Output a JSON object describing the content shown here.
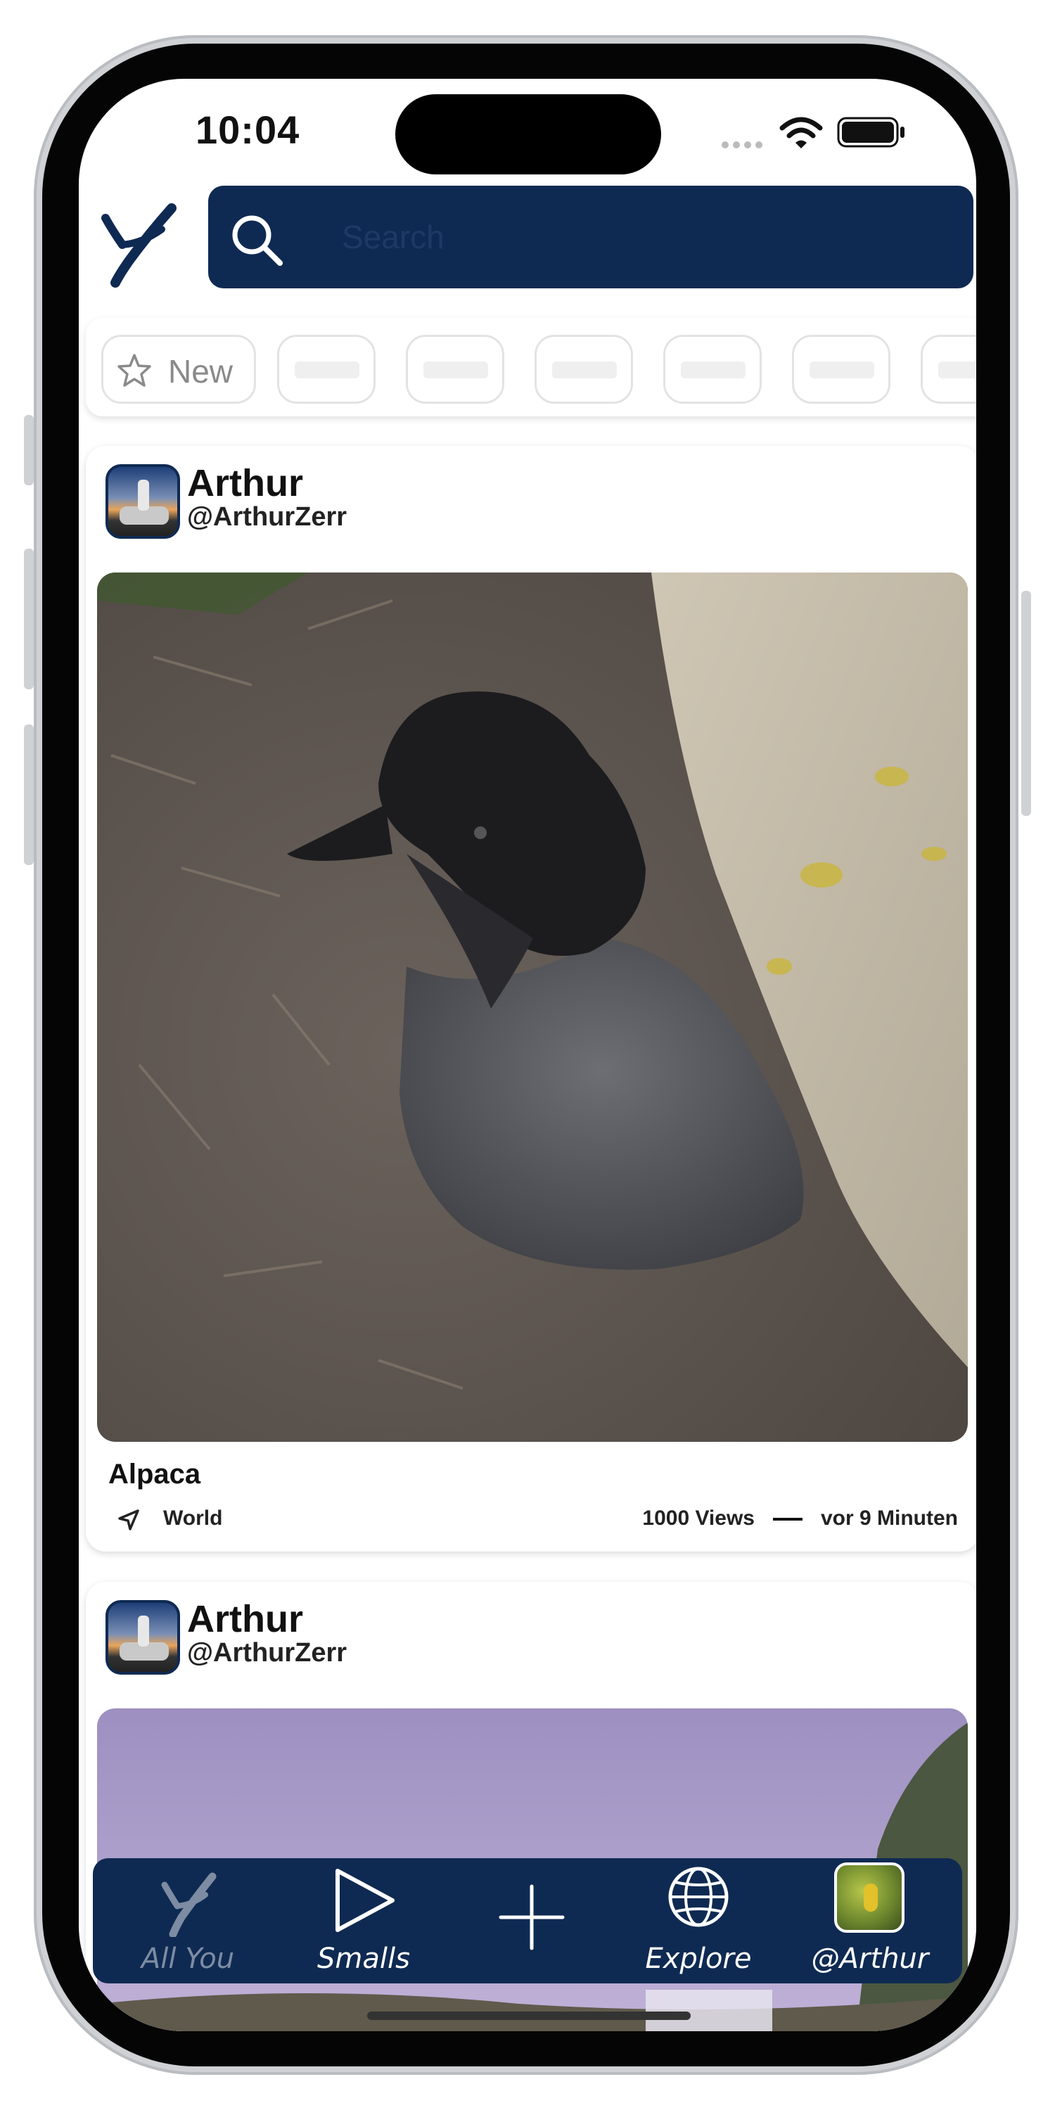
{
  "status_bar": {
    "time": "10:04"
  },
  "search": {
    "placeholder": "Search"
  },
  "filters": {
    "new_label": "New"
  },
  "posts": [
    {
      "name": "Arthur",
      "handle": "@ArthurZerr",
      "title": "Alpaca",
      "location": "World",
      "views": "1000 Views",
      "time": "vor 9 Minuten"
    },
    {
      "name": "Arthur",
      "handle": "@ArthurZerr"
    }
  ],
  "tabbar": {
    "tabs": [
      {
        "label": "All You",
        "icon": "y-logo-icon",
        "active": true
      },
      {
        "label": "Smalls",
        "icon": "play-icon"
      },
      {
        "label": "",
        "icon": "plus-icon"
      },
      {
        "label": "Explore",
        "icon": "globe-icon"
      },
      {
        "label": "@Arthur",
        "icon": "profile-avatar"
      }
    ]
  },
  "colors": {
    "brand": "#0f2a52",
    "inactive_tab": "#7d8ca3"
  }
}
